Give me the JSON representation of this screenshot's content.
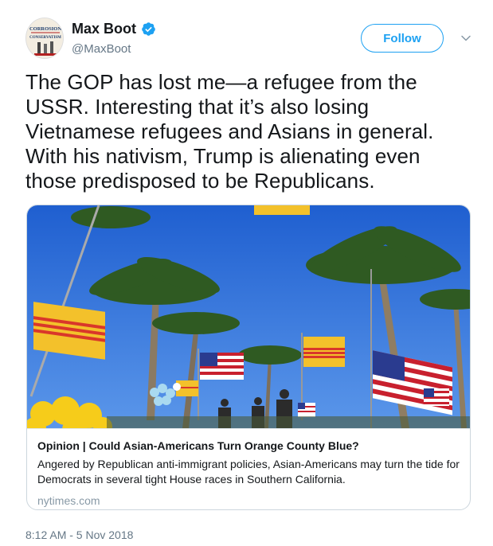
{
  "tweet": {
    "author": {
      "display_name": "Max Boot",
      "handle": "@MaxBoot",
      "verified": true,
      "avatar_text": [
        "CORROSION",
        "CONSERVATISM"
      ]
    },
    "follow_label": "Follow",
    "text": "The GOP has lost me—a refugee from the USSR. Interesting that it’s also losing Vietnamese refugees and Asians in general. With his nativism, Trump is alienating even those predisposed to be Republicans.",
    "timestamp": "8:12 AM - 5 Nov 2018"
  },
  "card": {
    "title": "Opinion | Could Asian-Americans Turn Orange County Blue?",
    "description": "Angered by Republican anti-immigrant policies, Asian-Americans may turn the tide for Democrats in several tight House races in Southern California.",
    "domain": "nytimes.com"
  },
  "colors": {
    "accent": "#1da1f2",
    "secondary_text": "#657786",
    "border": "#ccd6dd"
  },
  "icons": [
    "verified-badge-icon",
    "chevron-down-icon"
  ]
}
